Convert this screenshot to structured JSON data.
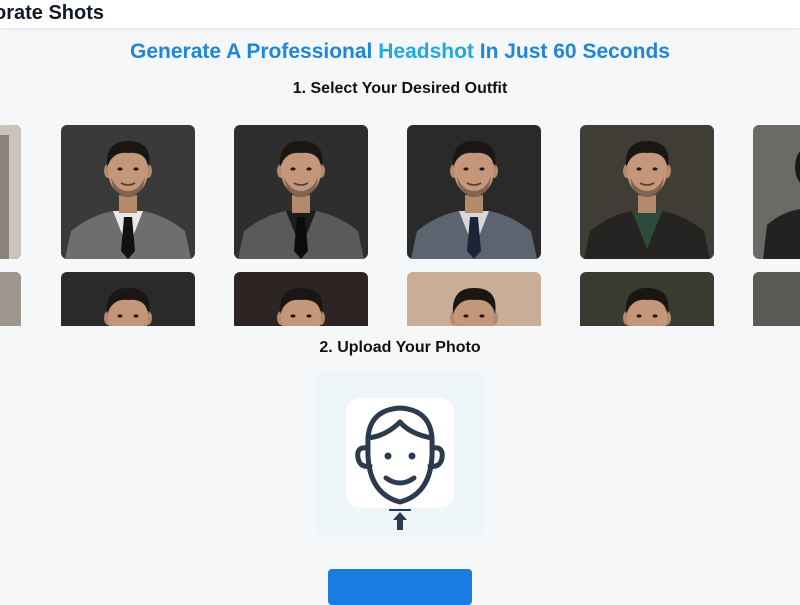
{
  "header": {
    "brand_text": "orate Shots"
  },
  "hero": {
    "headline_part1": "Generate A Professional ",
    "headline_part2": "Headshot",
    "headline_part3": " In Just 60 Seconds"
  },
  "step1": {
    "title": "1. Select Your Desired Outfit"
  },
  "step2": {
    "title": "2. Upload Your Photo"
  },
  "colors": {
    "headline_blue": "#2086dc",
    "headline_cyan": "#1fa9e6",
    "button_blue": "#1a7be0"
  },
  "outfits": [
    {
      "id": "outfit-grey-suit-white-shirt",
      "bg": "#3a3a3a",
      "suit": "#6e6e6e",
      "shirt": "#e8e8e8",
      "tie": "#111111"
    },
    {
      "id": "outfit-grey-suit-dark-shirt",
      "bg": "#2e2e2e",
      "suit": "#5a5a5a",
      "shirt": "#1c1c1c",
      "tie": "#0c0c0c"
    },
    {
      "id": "outfit-blue-grey-suit",
      "bg": "#2a2a2a",
      "suit": "#5c6470",
      "shirt": "#d8d8d8",
      "tie": "#1c2438"
    },
    {
      "id": "outfit-leather-jacket",
      "bg": "#3f3d36",
      "suit": "#252423",
      "shirt": "#2e4a3a",
      "tie": ""
    },
    {
      "id": "outfit-row2-1",
      "bg": "#2a2a2a",
      "suit": "#444444",
      "shirt": "#d0d0d0",
      "tie": ""
    },
    {
      "id": "outfit-row2-2",
      "bg": "#2d2523",
      "suit": "#333333",
      "shirt": "#cccccc",
      "tie": ""
    },
    {
      "id": "outfit-row2-3",
      "bg": "#c9ad97",
      "suit": "#555555",
      "shirt": "#dddddd",
      "tie": ""
    },
    {
      "id": "outfit-row2-4",
      "bg": "#3a3a32",
      "suit": "#333333",
      "shirt": "#2e4a3a",
      "tie": ""
    }
  ]
}
